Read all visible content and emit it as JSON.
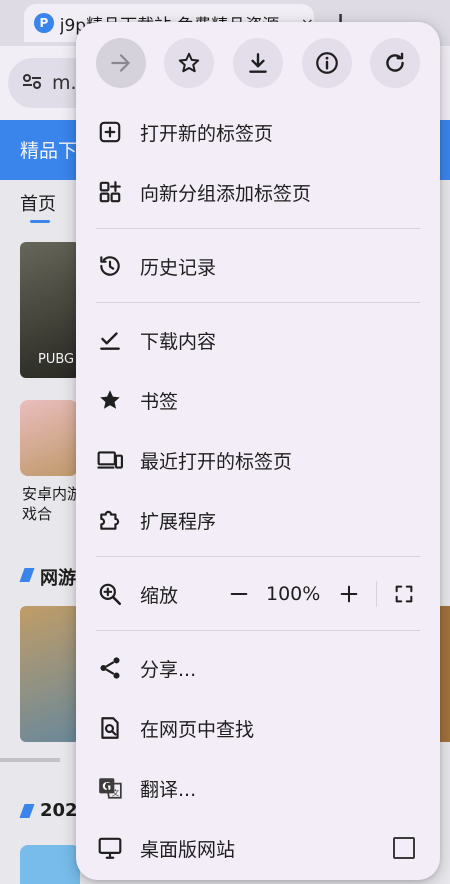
{
  "browser": {
    "tab_title": "j9p精品下载站-免费精品资源",
    "tab_favicon": "P",
    "tab_close": "×",
    "new_tab": "+",
    "omnibox_text": "m.j"
  },
  "page": {
    "banner_text": "精品下",
    "nav_home": "首页",
    "card1_label": "PUBG",
    "game_name": "安卓内游戏合",
    "section1": "网游",
    "section2": "202"
  },
  "menu": {
    "top_actions": [
      {
        "name": "forward",
        "icon": "arrow-right-icon",
        "enabled": false
      },
      {
        "name": "bookmark",
        "icon": "star-outline-icon"
      },
      {
        "name": "download",
        "icon": "download-icon"
      },
      {
        "name": "page-info",
        "icon": "info-icon"
      },
      {
        "name": "reload",
        "icon": "refresh-icon"
      }
    ],
    "items": {
      "new_tab": "打开新的标签页",
      "add_to_group": "向新分组添加标签页",
      "history": "历史记录",
      "downloads": "下载内容",
      "bookmarks": "书签",
      "recent_tabs": "最近打开的标签页",
      "extensions": "扩展程序",
      "zoom": "缩放",
      "share": "分享...",
      "find_in_page": "在网页中查找",
      "translate": "翻译...",
      "desktop_site": "桌面版网站"
    },
    "zoom_value": "100%",
    "desktop_site_checked": false
  }
}
